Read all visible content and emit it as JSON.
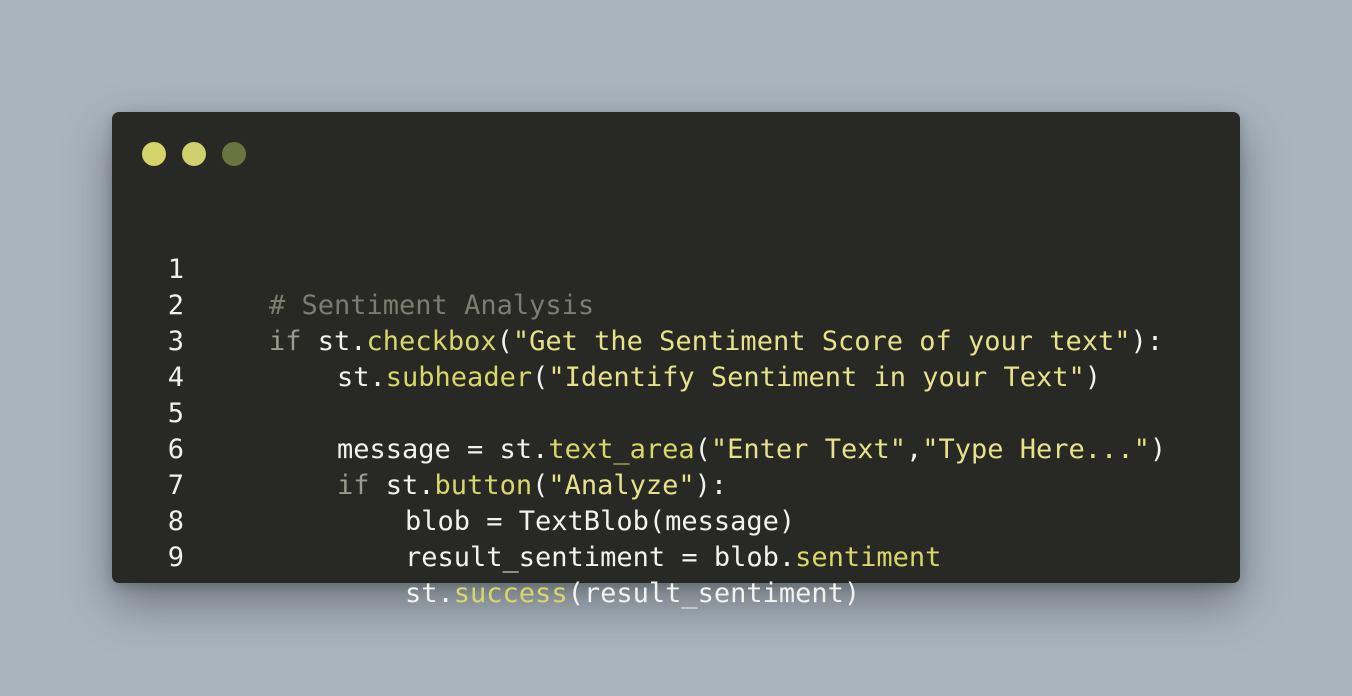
{
  "theme": {
    "background": "#a9b4be",
    "window_background": "#282824",
    "dot_colors": [
      "#d4d46a",
      "#d0d06c",
      "#6a7440"
    ]
  },
  "window_controls": [
    {
      "icon": "window-dot-icon"
    },
    {
      "icon": "window-dot-icon"
    },
    {
      "icon": "window-dot-icon"
    }
  ],
  "code": {
    "lines": [
      {
        "number": "1",
        "tokens": [
          {
            "type": "comment",
            "text": "# Sentiment Analysis"
          }
        ]
      },
      {
        "number": "2",
        "tokens": [
          {
            "type": "kw",
            "text": "if"
          },
          {
            "type": "plain",
            "text": " st."
          },
          {
            "type": "fn",
            "text": "checkbox"
          },
          {
            "type": "plain",
            "text": "("
          },
          {
            "type": "str",
            "text": "\"Get the Sentiment Score of your text\""
          },
          {
            "type": "plain",
            "text": "):"
          }
        ]
      },
      {
        "number": "3",
        "tokens": [
          {
            "type": "plain",
            "text": "st."
          },
          {
            "type": "fn",
            "text": "subheader"
          },
          {
            "type": "plain",
            "text": "("
          },
          {
            "type": "str",
            "text": "\"Identify Sentiment in your Text\""
          },
          {
            "type": "plain",
            "text": ")"
          }
        ]
      },
      {
        "number": "4",
        "tokens": []
      },
      {
        "number": "5",
        "tokens": [
          {
            "type": "plain",
            "text": "message = st."
          },
          {
            "type": "fn",
            "text": "text_area"
          },
          {
            "type": "plain",
            "text": "("
          },
          {
            "type": "str",
            "text": "\"Enter Text\""
          },
          {
            "type": "plain",
            "text": ","
          },
          {
            "type": "str",
            "text": "\"Type Here...\""
          },
          {
            "type": "plain",
            "text": ")"
          }
        ]
      },
      {
        "number": "6",
        "tokens": [
          {
            "type": "kw",
            "text": "if"
          },
          {
            "type": "plain",
            "text": " st."
          },
          {
            "type": "fn",
            "text": "button"
          },
          {
            "type": "plain",
            "text": "("
          },
          {
            "type": "str",
            "text": "\"Analyze\""
          },
          {
            "type": "plain",
            "text": "):"
          }
        ]
      },
      {
        "number": "7",
        "tokens": [
          {
            "type": "plain",
            "text": "blob = TextBlob(message)"
          }
        ]
      },
      {
        "number": "8",
        "tokens": [
          {
            "type": "plain",
            "text": "result_sentiment = blob."
          },
          {
            "type": "fn",
            "text": "sentiment"
          }
        ]
      },
      {
        "number": "9",
        "tokens": [
          {
            "type": "plain",
            "text": "st."
          },
          {
            "type": "fn",
            "text": "success"
          },
          {
            "type": "plain",
            "text": "(result_sentiment)"
          }
        ]
      }
    ]
  }
}
